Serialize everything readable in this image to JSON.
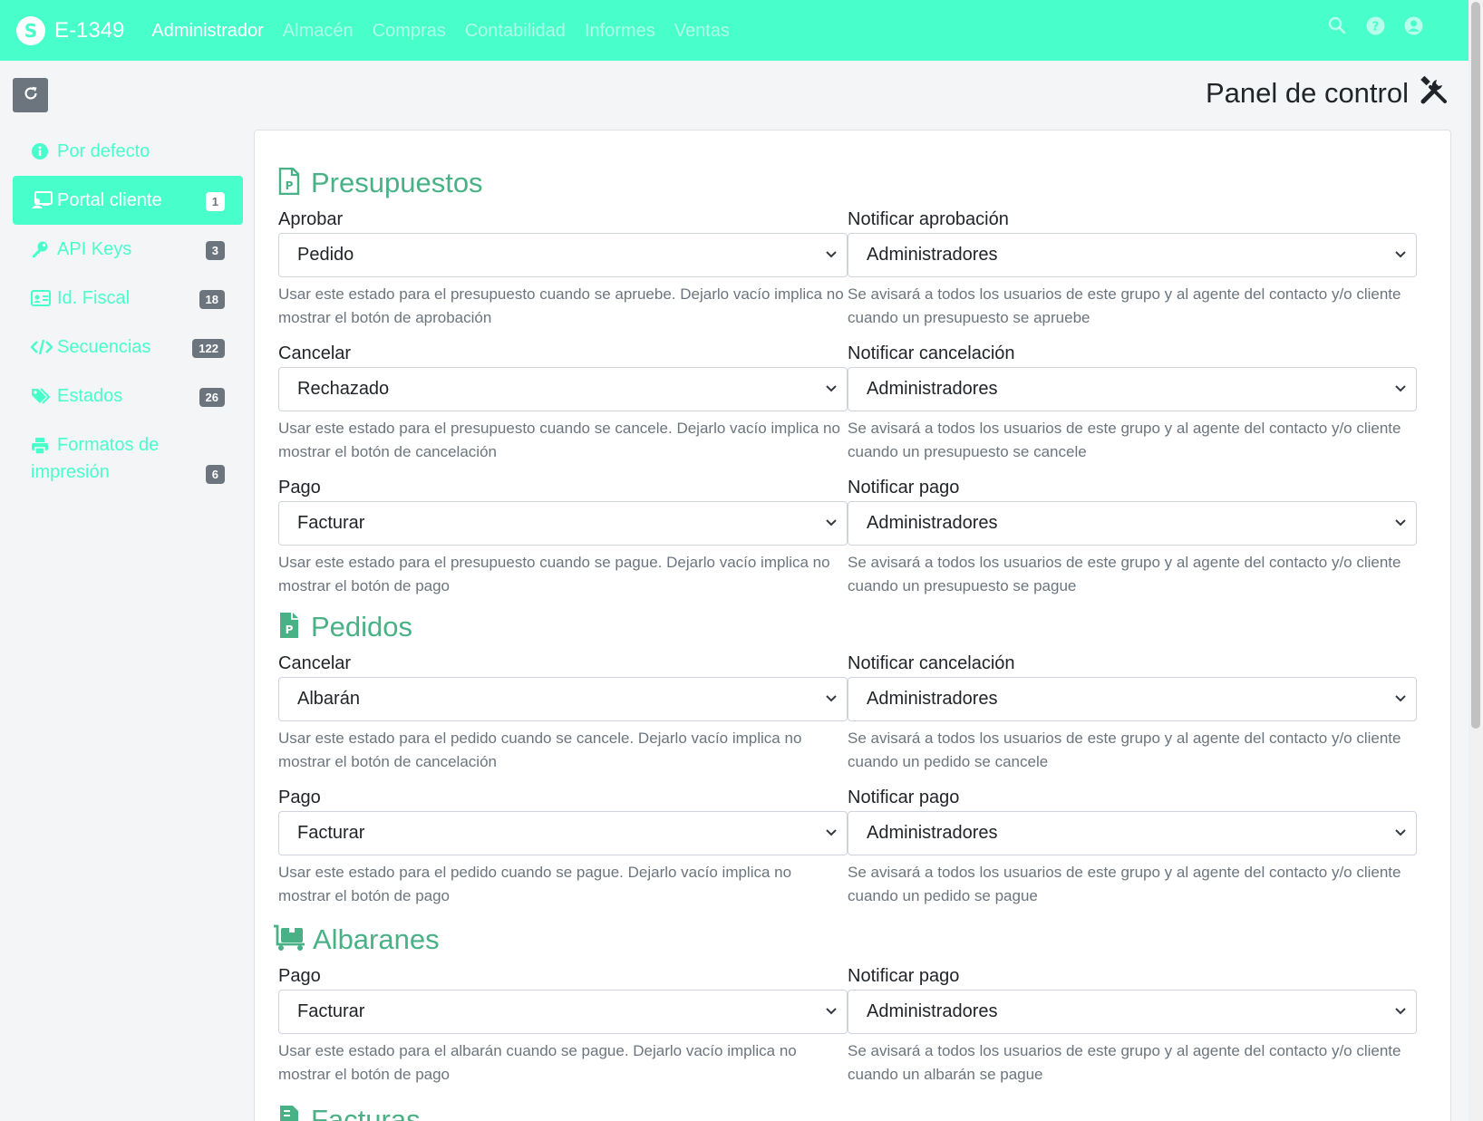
{
  "navbar": {
    "brand_icon": "S",
    "brand_name": "E-1349",
    "links": [
      "Administrador",
      "Almacén",
      "Compras",
      "Contabilidad",
      "Informes",
      "Ventas"
    ],
    "icons": [
      "search-icon",
      "help-icon",
      "user-icon"
    ]
  },
  "page": {
    "title": "Panel de control",
    "title_icon": "tools-icon"
  },
  "sidebar": {
    "items": [
      {
        "label": "Por defecto",
        "icon": "info-icon",
        "badge": ""
      },
      {
        "label": "Portal cliente",
        "icon": "portal-icon",
        "badge": "1",
        "active": true
      },
      {
        "label": "API Keys",
        "icon": "key-icon",
        "badge": "3"
      },
      {
        "label": "Id. Fiscal",
        "icon": "id-card-icon",
        "badge": "18"
      },
      {
        "label": "Secuencias",
        "icon": "code-icon",
        "badge": "122"
      },
      {
        "label": "Estados",
        "icon": "tags-icon",
        "badge": "26"
      },
      {
        "label": "Formatos de impresión",
        "icon": "print-icon",
        "badge": "6"
      }
    ]
  },
  "sections": {
    "presupuestos": {
      "title": "Presupuestos",
      "rows": [
        {
          "left": {
            "label": "Aprobar",
            "value": "Pedido",
            "help": "Usar este estado para el presupuesto cuando se apruebe. Dejarlo vacío implica no mostrar el botón de aprobación"
          },
          "right": {
            "label": "Notificar aprobación",
            "value": "Administradores",
            "help": "Se avisará a todos los usuarios de este grupo y al agente del contacto y/o cliente cuando un presupuesto se apruebe"
          }
        },
        {
          "left": {
            "label": "Cancelar",
            "value": "Rechazado",
            "help": "Usar este estado para el presupuesto cuando se cancele. Dejarlo vacío implica no mostrar el botón de cancelación"
          },
          "right": {
            "label": "Notificar cancelación",
            "value": "Administradores",
            "help": "Se avisará a todos los usuarios de este grupo y al agente del contacto y/o cliente cuando un presupuesto se cancele"
          }
        },
        {
          "left": {
            "label": "Pago",
            "value": "Facturar",
            "help": "Usar este estado para el presupuesto cuando se pague. Dejarlo vacío implica no mostrar el botón de pago"
          },
          "right": {
            "label": "Notificar pago",
            "value": "Administradores",
            "help": "Se avisará a todos los usuarios de este grupo y al agente del contacto y/o cliente cuando un presupuesto se pague"
          }
        }
      ]
    },
    "pedidos": {
      "title": "Pedidos",
      "rows": [
        {
          "left": {
            "label": "Cancelar",
            "value": "Albarán",
            "help": "Usar este estado para el pedido cuando se cancele. Dejarlo vacío implica no mostrar el botón de cancelación"
          },
          "right": {
            "label": "Notificar cancelación",
            "value": "Administradores",
            "help": "Se avisará a todos los usuarios de este grupo y al agente del contacto y/o cliente cuando un pedido se cancele"
          }
        },
        {
          "left": {
            "label": "Pago",
            "value": "Facturar",
            "help": "Usar este estado para el pedido cuando se pague. Dejarlo vacío implica no mostrar el botón de pago"
          },
          "right": {
            "label": "Notificar pago",
            "value": "Administradores",
            "help": "Se avisará a todos los usuarios de este grupo y al agente del contacto y/o cliente cuando un pedido se pague"
          }
        }
      ]
    },
    "albaranes": {
      "title": "Albaranes",
      "rows": [
        {
          "left": {
            "label": "Pago",
            "value": "Facturar",
            "help": "Usar este estado para el albarán cuando se pague. Dejarlo vacío implica no mostrar el botón de pago"
          },
          "right": {
            "label": "Notificar pago",
            "value": "Administradores",
            "help": "Se avisará a todos los usuarios de este grupo y al agente del contacto y/o cliente cuando un albarán se pague"
          }
        }
      ]
    },
    "facturas": {
      "title": "Facturas"
    }
  },
  "colors": {
    "accent": "#48ffcc",
    "section_title": "#48b185",
    "badge": "#6c757d"
  }
}
